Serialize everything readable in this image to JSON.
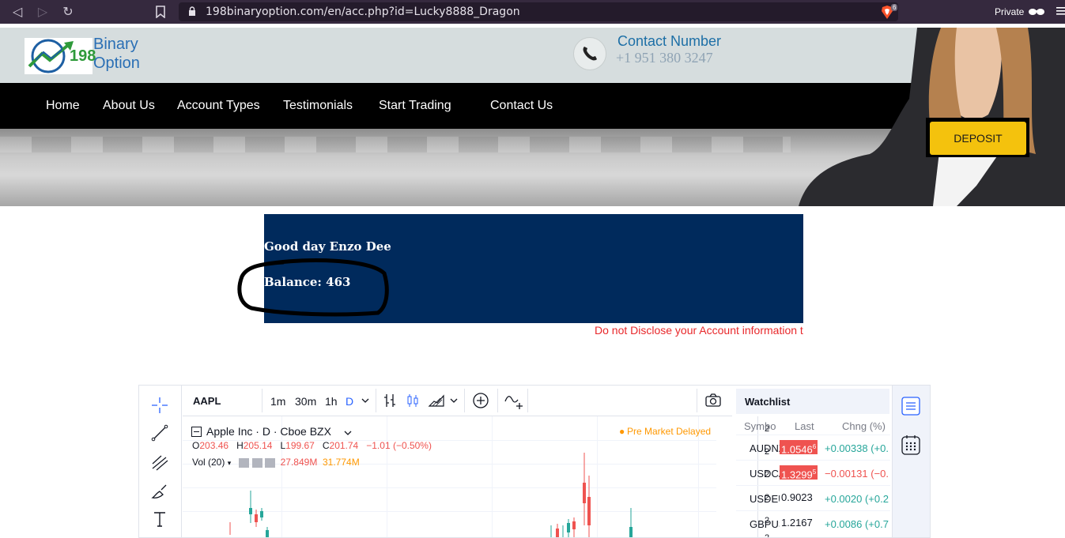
{
  "browser": {
    "url": "198binaryoption.com/en/acc.php?id=Lucky8888_Dragon",
    "private_label": "Private",
    "brave_badge": "6"
  },
  "header": {
    "logo_number": "198",
    "logo_line1": "Binary",
    "logo_line2": "Option",
    "contact_title": "Contact Number",
    "contact_number": "+1 951 380 3247"
  },
  "nav": {
    "items": [
      "Home",
      "About Us",
      "Account Types",
      "Testimonials",
      "Start Trading",
      "Contact Us"
    ]
  },
  "hero": {
    "deposit_label": "DEPOSIT"
  },
  "account": {
    "greeting": "Good day Enzo Dee",
    "balance": "Balance: 463",
    "warning": "Do not Disclose your Account information t"
  },
  "chart": {
    "symbol": "AAPL",
    "intervals": [
      "1m",
      "30m",
      "1h",
      "D"
    ],
    "active_interval": "D",
    "title": "Apple Inc · D · Cboe BZX",
    "status_dot": "●",
    "status": "Pre Market  Delayed",
    "ohlc": {
      "o_label": "O",
      "o": "203.46",
      "h_label": "H",
      "h": "205.14",
      "l_label": "L",
      "l": "199.67",
      "c_label": "C",
      "c": "201.74",
      "change": "−1.01 (−0.50%)"
    },
    "volume": {
      "label": "Vol (20)",
      "v1": "27.849M",
      "v2": "31.774M"
    },
    "price_ticks": [
      "2",
      "2",
      "2",
      "2",
      "2",
      "2"
    ]
  },
  "watchlist": {
    "title": "Watchlist",
    "columns": [
      "Symbo",
      "Last",
      "Chng (%)"
    ],
    "rows": [
      {
        "symbol": "AUDNZD",
        "last": "1.0546",
        "last_sup": "6",
        "change": "+0.00338 (+0.",
        "direction": "pos",
        "last_highlight": true
      },
      {
        "symbol": "USDCAD",
        "last": "1.3299",
        "last_sup": "5",
        "change": "−0.00131 (−0.",
        "direction": "neg",
        "last_highlight": true
      },
      {
        "symbol": "USDEUR",
        "last": "0.9023",
        "last_sup": "",
        "change": "+0.0020 (+0.2",
        "direction": "pos",
        "last_highlight": false
      },
      {
        "symbol": "GBPUSD",
        "last": "1.2167",
        "last_sup": "",
        "change": "+0.0086 (+0.7",
        "direction": "pos",
        "last_highlight": false
      }
    ]
  },
  "colors": {
    "browser_bg": "#35293e",
    "nav_bg": "#000000",
    "account_box": "#002a5c",
    "deposit": "#f4c20d",
    "warning": "#e8282b",
    "candle_up": "#26a69a",
    "candle_down": "#ef5350"
  }
}
